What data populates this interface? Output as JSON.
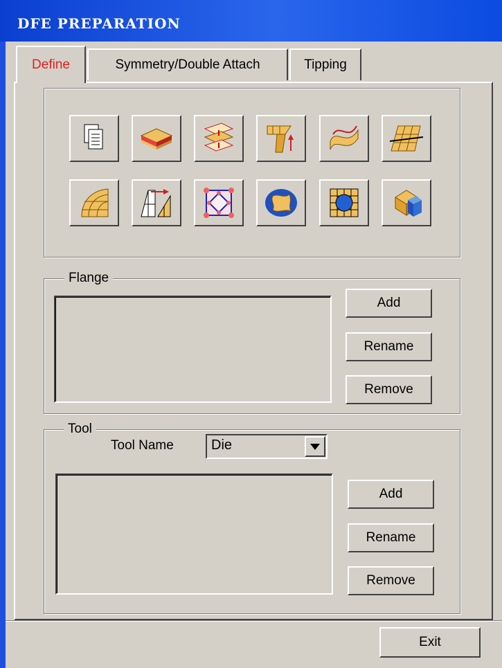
{
  "window": {
    "title": "DFE PREPARATION"
  },
  "tabs": [
    {
      "label": "Define",
      "active": true
    },
    {
      "label": "Symmetry/Double Attach",
      "active": false
    },
    {
      "label": "Tipping",
      "active": false
    }
  ],
  "toolbar": {
    "icons": [
      "copy-pages-icon",
      "layered-sheet-icon",
      "offset-surfaces-icon",
      "flange-up-icon",
      "twisted-surface-icon",
      "surface-mesh-icon",
      "curved-mesh-icon",
      "extend-mesh-icon",
      "boundary-nodes-icon",
      "elliptical-shape-icon",
      "grid-hole-icon",
      "solid-intersect-icon"
    ]
  },
  "flange": {
    "legend": "Flange",
    "add_label": "Add",
    "rename_label": "Rename",
    "remove_label": "Remove"
  },
  "tool": {
    "legend": "Tool",
    "tool_name_label": "Tool Name",
    "tool_name_value": "Die",
    "add_label": "Add",
    "rename_label": "Rename",
    "remove_label": "Remove"
  },
  "footer": {
    "exit_label": "Exit"
  }
}
